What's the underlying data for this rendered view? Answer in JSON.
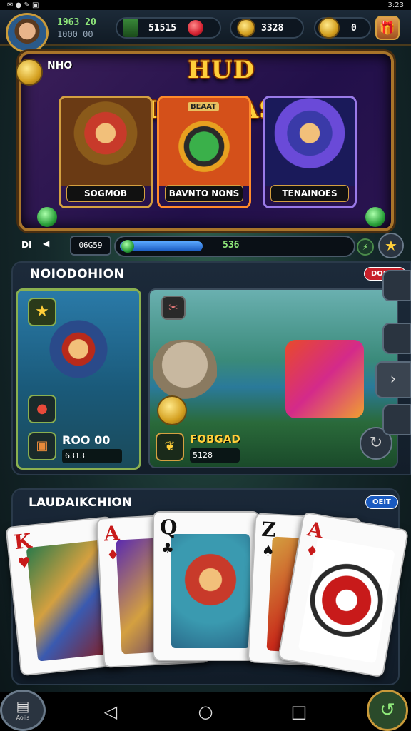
{
  "status_bar": {
    "time": "3:23"
  },
  "header": {
    "player_score": "1963 20",
    "player_sub": "1000 00",
    "gems": "51515",
    "coins": "3328",
    "trophies": "0"
  },
  "banner": {
    "title": "HUD IIDAREASA!",
    "coin_label": "NHO",
    "promos": [
      {
        "label": "SOGMOB"
      },
      {
        "label": "BAVNTO NONS"
      },
      {
        "label": "TENAINOES"
      }
    ],
    "promo2_sign": "BEAAT"
  },
  "progress": {
    "left_label": "DI",
    "count": "06G59",
    "value": "536",
    "fill_fraction": 0.36
  },
  "featured": {
    "title": "NOIODOHION",
    "badge": "DOEGE",
    "hero_card": {
      "amount": "ROO 00",
      "sub": "6313"
    },
    "fishing_card": {
      "name": "FOBGAD",
      "sub": "5128"
    }
  },
  "deck": {
    "title": "LAUDAIKCHION",
    "badge": "OEIT",
    "cards": [
      {
        "rank": "K"
      },
      {
        "rank": "A"
      },
      {
        "rank": "Q"
      },
      {
        "rank": "Z"
      },
      {
        "rank": "A"
      }
    ]
  },
  "bottom": {
    "store_label": "Aoiis"
  },
  "colors": {
    "gold": "#d4a040",
    "banner_purple": "#3a1e58",
    "progress_blue": "#2a78e8"
  }
}
